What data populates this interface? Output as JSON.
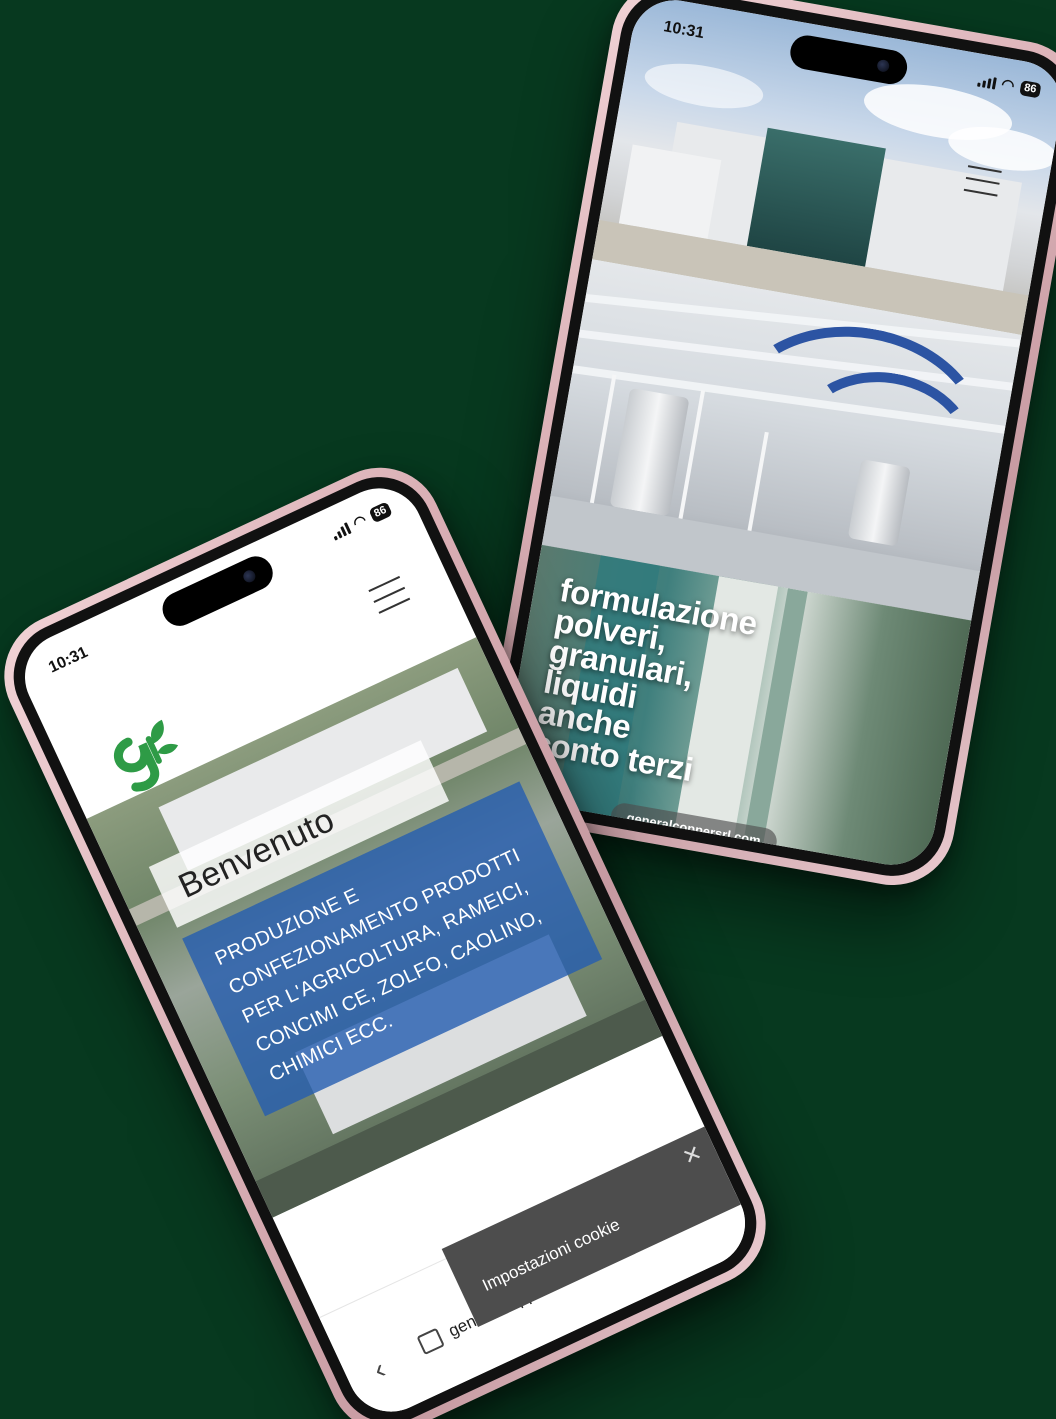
{
  "phone_right": {
    "status": {
      "time": "10:31",
      "battery": "86"
    },
    "hero_lines": [
      "formulazione",
      "polveri,",
      "granulari,",
      "liquidi",
      "anche",
      "conto terzi"
    ],
    "url": "generalcoppersrl.com"
  },
  "phone_left": {
    "status": {
      "time": "10:31",
      "battery": "86"
    },
    "welcome_title": "Benvenuto",
    "welcome_body": "PRODUZIONE E CONFEZIONAMENTO PRODOTTI PER L'AGRICOLTURA, RAMEICI, CONCIMI CE, ZOLFO, CAOLINO, CHIMICI ECC.",
    "cookie_label": "Impostazioni cookie",
    "cookie_close": "✕",
    "browser": {
      "url": "generalcoppersrl.com",
      "back": "‹",
      "reload": "↻",
      "more": "···"
    }
  },
  "colors": {
    "background": "#07391f",
    "phone_shell": "#d9aeb4",
    "welcome_blue": "#245cb0",
    "logo_green": "#2e9b46"
  }
}
